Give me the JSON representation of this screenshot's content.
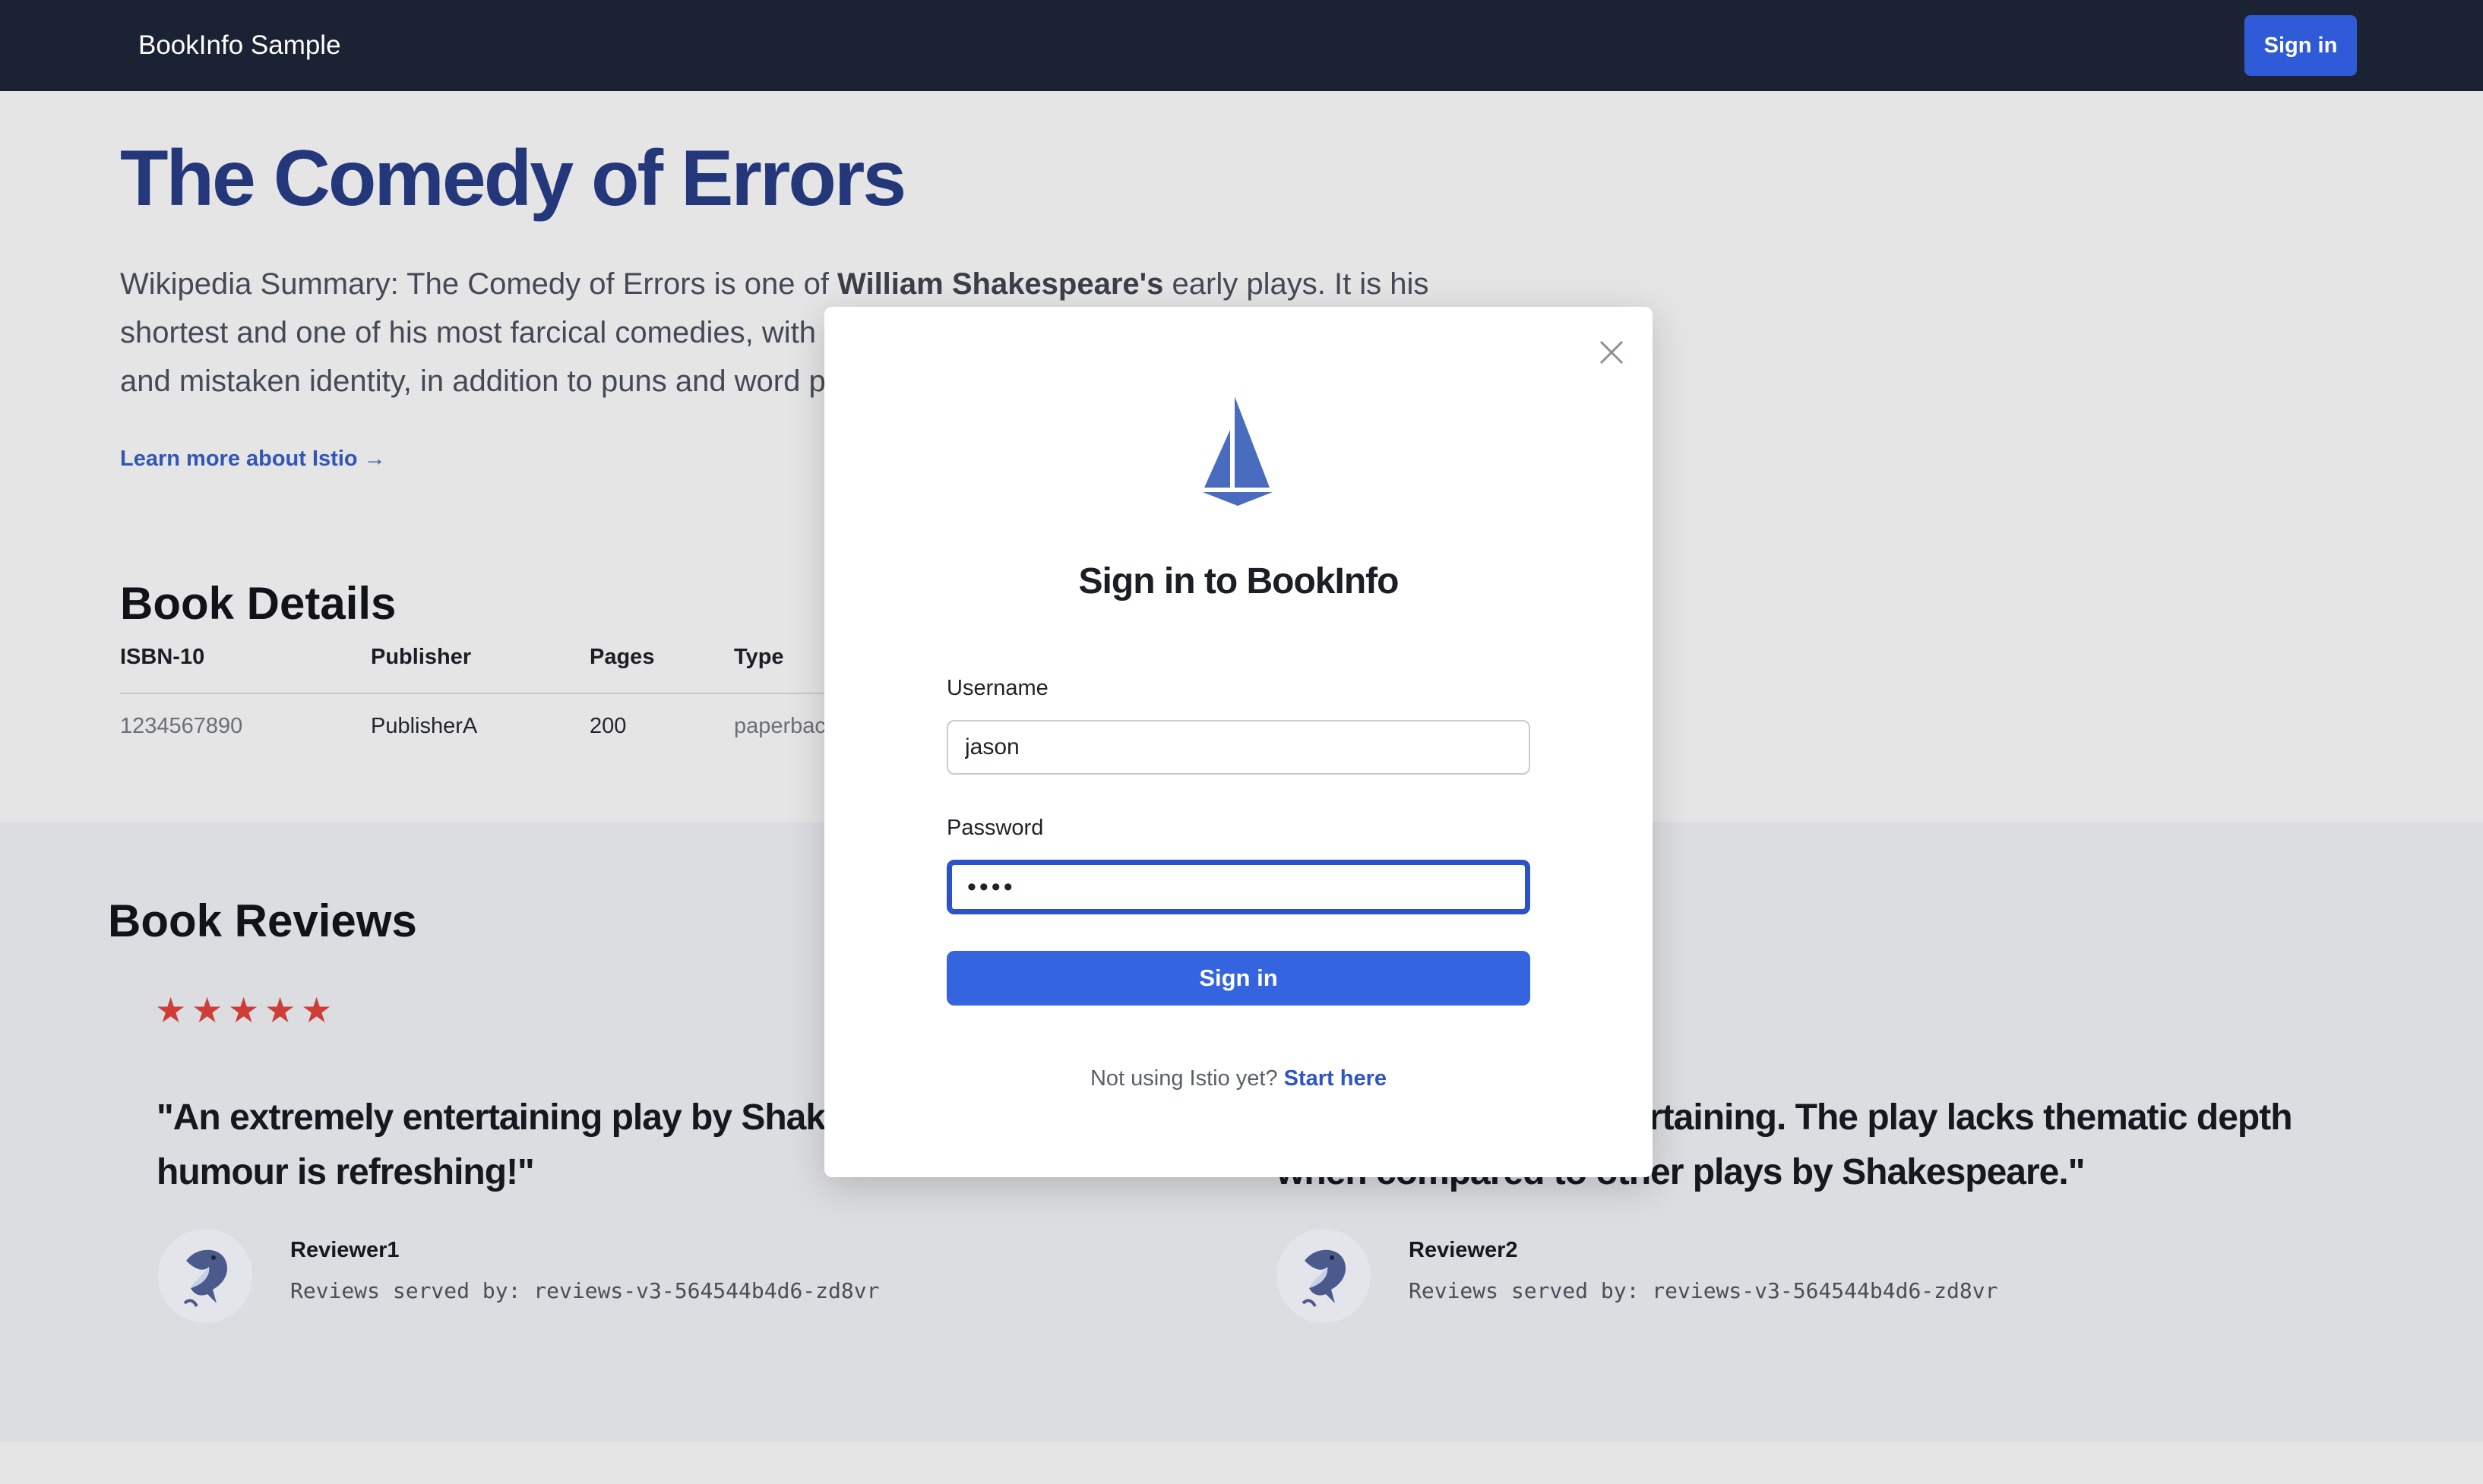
{
  "navbar": {
    "brand": "BookInfo Sample",
    "signin_label": "Sign in",
    "background": "#1b2233",
    "accent": "#2f5bd8"
  },
  "book": {
    "title": "The Comedy of Errors",
    "summary_prefix": "Wikipedia Summary: The Comedy of Errors is one of ",
    "summary_bold": "William Shakespeare's",
    "summary_line1_rest": " early plays. It is his",
    "summary_line2": "shortest and one of his most farcical comedies, with a",
    "summary_line3": "and mistaken identity, in addition to puns and word pl",
    "learn_more": "Learn more about Istio →"
  },
  "details": {
    "title": "Book Details",
    "columns": [
      "ISBN-10",
      "Publisher",
      "Pages",
      "Type"
    ],
    "row": {
      "isbn": "1234567890",
      "publisher": "PublisherA",
      "pages": "200",
      "type": "paperbac"
    }
  },
  "reviews": {
    "title": "Book Reviews",
    "rating": {
      "stars": 5,
      "color": "#cf3d38"
    },
    "items": [
      {
        "quote_line1": "\"An extremely entertaining play by Shakesp",
        "quote_line2": "humour is refreshing!\"",
        "reviewer": "Reviewer1",
        "served_by": "Reviews served by: reviews-v3-564544b4d6-zd8vr"
      },
      {
        "quote_line1": "rtaining. The play lacks thematic depth",
        "quote_line2": "when compared to other plays by Shakespeare.\"",
        "reviewer": "Reviewer2",
        "served_by": "Reviews served by: reviews-v3-564544b4d6-zd8vr"
      }
    ]
  },
  "modal": {
    "title": "Sign in to BookInfo",
    "username_label": "Username",
    "username_value": "jason",
    "password_label": "Password",
    "password_value": "••••",
    "submit_label": "Sign in",
    "footer_text": "Not using Istio yet? ",
    "footer_link": "Start here",
    "icons": {
      "close": "close-icon",
      "logo": "istio-sail-logo"
    }
  }
}
